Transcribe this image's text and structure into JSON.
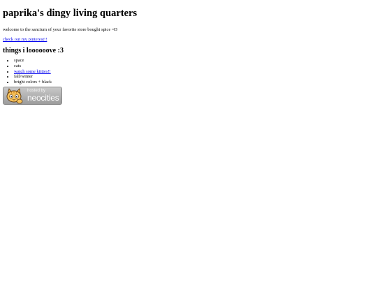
{
  "page": {
    "title": "paprika's dingy living quarters",
    "welcome": "welcome to the sanctum of your favorite store bought spice =D",
    "pinterest_link": "check out my pinterest!!",
    "subheading": "things i loooooove :3",
    "likes": [
      {
        "text": "space",
        "link": false
      },
      {
        "text": "cats",
        "link": false
      },
      {
        "text": "watch some kitties!!",
        "link": true
      },
      {
        "text": "fall/winter",
        "link": false
      },
      {
        "text": "bright colors + black",
        "link": false
      }
    ]
  },
  "badge": {
    "hosted_by": "hosted by",
    "brand": "neocities",
    "icon": "neocities-cat-icon"
  },
  "colors": {
    "link": "#0000ee",
    "text": "#000000",
    "badge_bg": "#a8a8a8"
  }
}
